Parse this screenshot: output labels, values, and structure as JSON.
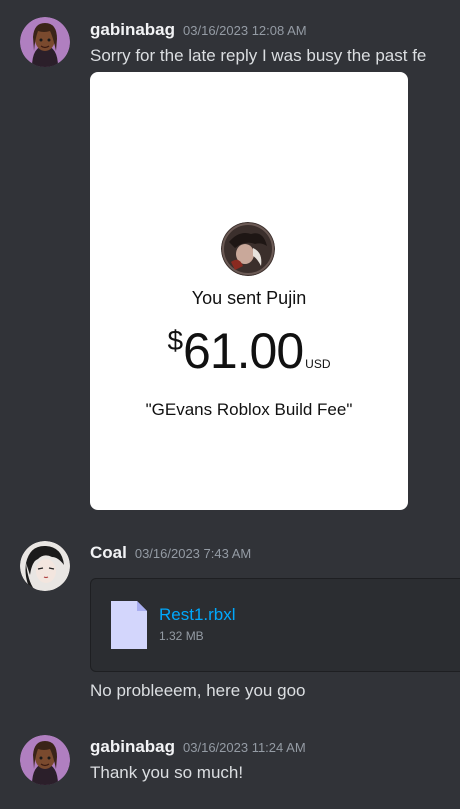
{
  "messages": [
    {
      "username": "gabinabag",
      "timestamp": "03/16/2023 12:08 AM",
      "text": "Sorry for the late reply I was busy the past fe",
      "payment": {
        "sent_text": "You sent Pujin",
        "currency_symbol": "$",
        "amount": "61.00",
        "currency": "USD",
        "note": "\"GEvans Roblox Build Fee\""
      }
    },
    {
      "username": "Coal",
      "timestamp": "03/16/2023 7:43 AM",
      "attachment": {
        "file_name": "Rest1.rbxl",
        "file_size": "1.32 MB"
      },
      "text": "No probleeem, here you goo"
    },
    {
      "username": "gabinabag",
      "timestamp": "03/16/2023 11:24 AM",
      "text": "Thank you so much!"
    }
  ],
  "colors": {
    "background": "#313338",
    "username": "#f2f3f5",
    "timestamp": "#949ba4",
    "text": "#dbdee1",
    "link": "#00a8fc",
    "attachment_bg": "#2b2d31"
  }
}
